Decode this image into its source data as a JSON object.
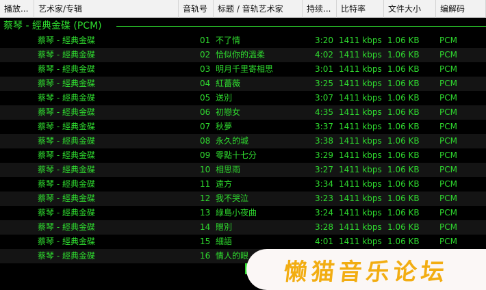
{
  "columns": [
    {
      "key": "playing",
      "label": "播放...",
      "width": 50
    },
    {
      "key": "artist_album",
      "label": "艺术家/专辑",
      "width": 211
    },
    {
      "key": "track_no",
      "label": "音轨号",
      "width": 51
    },
    {
      "key": "title",
      "label": "标题 / 音轨艺术家",
      "width": 130
    },
    {
      "key": "duration",
      "label": "持续...",
      "width": 50
    },
    {
      "key": "bitrate",
      "label": "比特率",
      "width": 69
    },
    {
      "key": "filesize",
      "label": "文件大小",
      "width": 76
    },
    {
      "key": "codec",
      "label": "编解码",
      "width": 73
    }
  ],
  "group": {
    "title": "蔡琴 - 經典金碟 (PCM)"
  },
  "rows": [
    {
      "album": "蔡琴 - 經典金碟",
      "track": "01",
      "title": "不了情",
      "duration": "3:20",
      "bitrate": "1411 kbps",
      "size": "1.06 KB",
      "codec": "PCM"
    },
    {
      "album": "蔡琴 - 經典金碟",
      "track": "02",
      "title": "恰似你的溫柔",
      "duration": "4:02",
      "bitrate": "1411 kbps",
      "size": "1.06 KB",
      "codec": "PCM"
    },
    {
      "album": "蔡琴 - 經典金碟",
      "track": "03",
      "title": "明月千里寄相思",
      "duration": "3:01",
      "bitrate": "1411 kbps",
      "size": "1.06 KB",
      "codec": "PCM"
    },
    {
      "album": "蔡琴 - 經典金碟",
      "track": "04",
      "title": "紅薔薇",
      "duration": "3:25",
      "bitrate": "1411 kbps",
      "size": "1.06 KB",
      "codec": "PCM"
    },
    {
      "album": "蔡琴 - 經典金碟",
      "track": "05",
      "title": "送別",
      "duration": "3:07",
      "bitrate": "1411 kbps",
      "size": "1.06 KB",
      "codec": "PCM"
    },
    {
      "album": "蔡琴 - 經典金碟",
      "track": "06",
      "title": "初戀女",
      "duration": "4:35",
      "bitrate": "1411 kbps",
      "size": "1.06 KB",
      "codec": "PCM"
    },
    {
      "album": "蔡琴 - 經典金碟",
      "track": "07",
      "title": "秋夢",
      "duration": "3:37",
      "bitrate": "1411 kbps",
      "size": "1.06 KB",
      "codec": "PCM"
    },
    {
      "album": "蔡琴 - 經典金碟",
      "track": "08",
      "title": "永久的城",
      "duration": "3:38",
      "bitrate": "1411 kbps",
      "size": "1.06 KB",
      "codec": "PCM"
    },
    {
      "album": "蔡琴 - 經典金碟",
      "track": "09",
      "title": "零點十七分",
      "duration": "3:29",
      "bitrate": "1411 kbps",
      "size": "1.06 KB",
      "codec": "PCM"
    },
    {
      "album": "蔡琴 - 經典金碟",
      "track": "10",
      "title": "相思雨",
      "duration": "3:27",
      "bitrate": "1411 kbps",
      "size": "1.06 KB",
      "codec": "PCM"
    },
    {
      "album": "蔡琴 - 經典金碟",
      "track": "11",
      "title": "遠方",
      "duration": "3:34",
      "bitrate": "1411 kbps",
      "size": "1.06 KB",
      "codec": "PCM"
    },
    {
      "album": "蔡琴 - 經典金碟",
      "track": "12",
      "title": "我不哭泣",
      "duration": "3:23",
      "bitrate": "1411 kbps",
      "size": "1.06 KB",
      "codec": "PCM"
    },
    {
      "album": "蔡琴 - 經典金碟",
      "track": "13",
      "title": "綠島小夜曲",
      "duration": "3:24",
      "bitrate": "1411 kbps",
      "size": "1.06 KB",
      "codec": "PCM"
    },
    {
      "album": "蔡琴 - 經典金碟",
      "track": "14",
      "title": "贈別",
      "duration": "3:28",
      "bitrate": "1411 kbps",
      "size": "1.06 KB",
      "codec": "PCM"
    },
    {
      "album": "蔡琴 - 經典金碟",
      "track": "15",
      "title": "細語",
      "duration": "4:01",
      "bitrate": "1411 kbps",
      "size": "1.06 KB",
      "codec": "PCM"
    },
    {
      "album": "蔡琴 - 經典金碟",
      "track": "16",
      "title": "情人的眼",
      "duration": "",
      "bitrate": "",
      "size": "",
      "codec": ""
    }
  ],
  "watermark": {
    "text": "懒猫音乐论坛"
  },
  "colors": {
    "text": "#2fdc2f",
    "background": "#000000",
    "header": "#f2f2f2",
    "watermark": "#f2ad12"
  }
}
